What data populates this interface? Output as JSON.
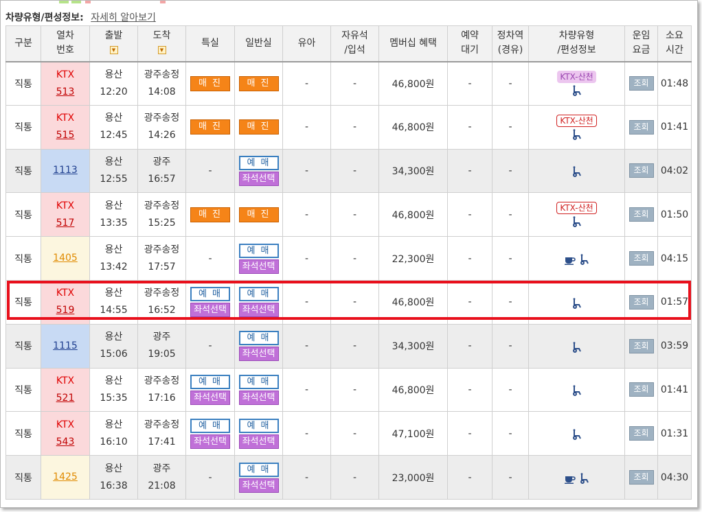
{
  "header": {
    "title": "차량유형/편성정보:",
    "link": "자세히 알아보기"
  },
  "columns": {
    "type": "구분",
    "train_no_1": "열차",
    "train_no_2": "번호",
    "dep": "출발",
    "arr": "도착",
    "special": "특실",
    "general": "일반실",
    "child": "유아",
    "free_1": "자유석",
    "free_2": "/입석",
    "member": "멤버십 혜택",
    "wait_1": "예약",
    "wait_2": "대기",
    "stop_1": "정차역",
    "stop_2": "(경유)",
    "vehicle_1": "차량유형",
    "vehicle_2": "/편성정보",
    "fare_1": "운임",
    "fare_2": "요금",
    "time_1": "소요",
    "time_2": "시간",
    "sort_glyph": "▼"
  },
  "labels": {
    "sold_out": "매 진",
    "book": "예 매",
    "seat": "좌석선택",
    "dash": "-",
    "query": "조회",
    "ktx_sancheon": "KTX-산천"
  },
  "rows": [
    {
      "type": "직통",
      "train_type": "KTX",
      "train_no": "513",
      "dep_station": "용산",
      "dep_time": "12:20",
      "arr_station": "광주송정",
      "arr_time": "14:08",
      "special": "sold",
      "general": "sold",
      "child": "-",
      "free": "-",
      "member": "46,800원",
      "wait": "-",
      "stop": "-",
      "vehicle": "ktx-sancheon-1",
      "duration": "01:48",
      "highlighted": false,
      "shaded": false
    },
    {
      "type": "직통",
      "train_type": "KTX",
      "train_no": "515",
      "dep_station": "용산",
      "dep_time": "12:45",
      "arr_station": "광주송정",
      "arr_time": "14:26",
      "special": "sold",
      "general": "sold",
      "child": "-",
      "free": "-",
      "member": "46,800원",
      "wait": "-",
      "stop": "-",
      "vehicle": "ktx-sancheon-2",
      "duration": "01:41",
      "highlighted": false,
      "shaded": false
    },
    {
      "type": "직통",
      "train_type": "",
      "train_no": "1113",
      "dep_station": "용산",
      "dep_time": "12:55",
      "arr_station": "광주",
      "arr_time": "16:57",
      "special": "none",
      "general": "book",
      "child": "-",
      "free": "-",
      "member": "34,300원",
      "wait": "-",
      "stop": "-",
      "vehicle": "wheelchair",
      "duration": "04:02",
      "highlighted": false,
      "shaded": true,
      "color_class": "mugunghwa"
    },
    {
      "type": "직통",
      "train_type": "KTX",
      "train_no": "517",
      "dep_station": "용산",
      "dep_time": "13:35",
      "arr_station": "광주송정",
      "arr_time": "15:25",
      "special": "sold",
      "general": "sold",
      "child": "-",
      "free": "-",
      "member": "46,800원",
      "wait": "-",
      "stop": "-",
      "vehicle": "ktx-sancheon-2",
      "duration": "01:50",
      "highlighted": false,
      "shaded": false
    },
    {
      "type": "직통",
      "train_type": "",
      "train_no": "1405",
      "dep_station": "용산",
      "dep_time": "13:42",
      "arr_station": "광주송정",
      "arr_time": "17:57",
      "special": "none",
      "general": "book",
      "child": "-",
      "free": "-",
      "member": "22,300원",
      "wait": "-",
      "stop": "-",
      "vehicle": "cafe-wheelchair",
      "duration": "04:15",
      "highlighted": false,
      "shaded": false,
      "color_class": "itx"
    },
    {
      "type": "직통",
      "train_type": "KTX",
      "train_no": "519",
      "dep_station": "용산",
      "dep_time": "14:55",
      "arr_station": "광주송정",
      "arr_time": "16:52",
      "special": "book",
      "general": "book",
      "child": "-",
      "free": "-",
      "member": "46,800원",
      "wait": "-",
      "stop": "-",
      "vehicle": "wheelchair",
      "duration": "01:57",
      "highlighted": true,
      "shaded": false
    },
    {
      "type": "직통",
      "train_type": "",
      "train_no": "1115",
      "dep_station": "용산",
      "dep_time": "15:06",
      "arr_station": "광주",
      "arr_time": "19:05",
      "special": "none",
      "general": "book",
      "child": "-",
      "free": "-",
      "member": "34,300원",
      "wait": "-",
      "stop": "-",
      "vehicle": "wheelchair",
      "duration": "03:59",
      "highlighted": false,
      "shaded": true,
      "color_class": "mugunghwa"
    },
    {
      "type": "직통",
      "train_type": "KTX",
      "train_no": "521",
      "dep_station": "용산",
      "dep_time": "15:35",
      "arr_station": "광주송정",
      "arr_time": "17:16",
      "special": "book",
      "general": "book",
      "child": "-",
      "free": "-",
      "member": "46,800원",
      "wait": "-",
      "stop": "-",
      "vehicle": "wheelchair",
      "duration": "01:41",
      "highlighted": false,
      "shaded": false
    },
    {
      "type": "직통",
      "train_type": "KTX",
      "train_no": "543",
      "dep_station": "용산",
      "dep_time": "16:10",
      "arr_station": "광주송정",
      "arr_time": "17:41",
      "special": "book",
      "general": "book",
      "child": "-",
      "free": "-",
      "member": "47,100원",
      "wait": "-",
      "stop": "-",
      "vehicle": "wheelchair",
      "duration": "01:31",
      "highlighted": false,
      "shaded": false
    },
    {
      "type": "직통",
      "train_type": "",
      "train_no": "1425",
      "dep_station": "용산",
      "dep_time": "16:38",
      "arr_station": "광주",
      "arr_time": "21:08",
      "special": "none",
      "general": "book",
      "child": "-",
      "free": "-",
      "member": "23,000원",
      "wait": "-",
      "stop": "-",
      "vehicle": "cafe-wheelchair",
      "duration": "04:30",
      "highlighted": false,
      "shaded": true,
      "color_class": "itx"
    }
  ],
  "colors": {
    "ktx_bg": "#fbd9db",
    "mugunghwa_bg": "#c8daf4",
    "itx_bg": "#fcf6df",
    "sold_out": "#f58418",
    "seat_select": "#c070d8",
    "highlight": "#e8101c"
  }
}
